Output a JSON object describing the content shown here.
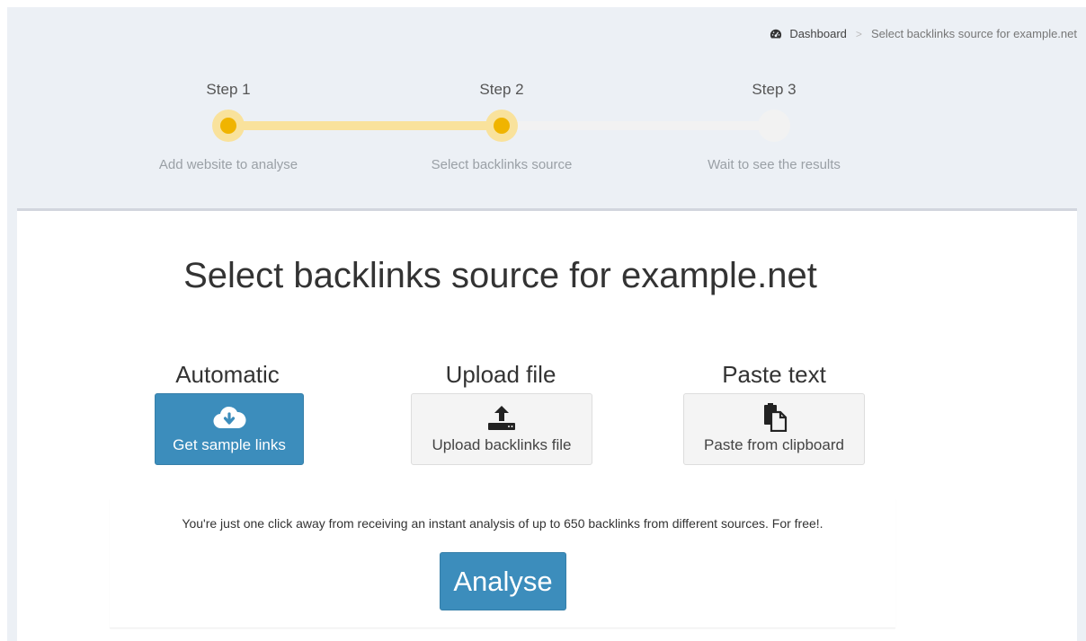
{
  "breadcrumb": {
    "home_icon": "dashboard-icon",
    "home_label": "Dashboard",
    "separator": ">",
    "current": "Select backlinks source for example.net"
  },
  "wizard": {
    "steps": [
      {
        "title": "Step 1",
        "description": "Add website to analyse",
        "state": "done"
      },
      {
        "title": "Step 2",
        "description": "Select backlinks source",
        "state": "active"
      },
      {
        "title": "Step 3",
        "description": "Wait to see the results",
        "state": "pending"
      }
    ],
    "colors": {
      "progress": "#f9e29c",
      "dot": "#f0b400",
      "pending": "#f2f2f2"
    }
  },
  "main": {
    "title": "Select backlinks source for example.net",
    "options": [
      {
        "heading": "Automatic",
        "button_label": "Get sample links",
        "icon": "cloud-download-icon",
        "style": "primary"
      },
      {
        "heading": "Upload file",
        "button_label": "Upload backlinks file",
        "icon": "upload-icon",
        "style": "default"
      },
      {
        "heading": "Paste text",
        "button_label": "Paste from clipboard",
        "icon": "clipboard-icon",
        "style": "default"
      }
    ],
    "note": "You're just one click away from receiving an instant analysis of up to 650 backlinks from different sources. For free!.",
    "analyse_label": "Analyse"
  },
  "colors": {
    "accent": "#3c8dbc",
    "background": "#ecf0f5"
  }
}
